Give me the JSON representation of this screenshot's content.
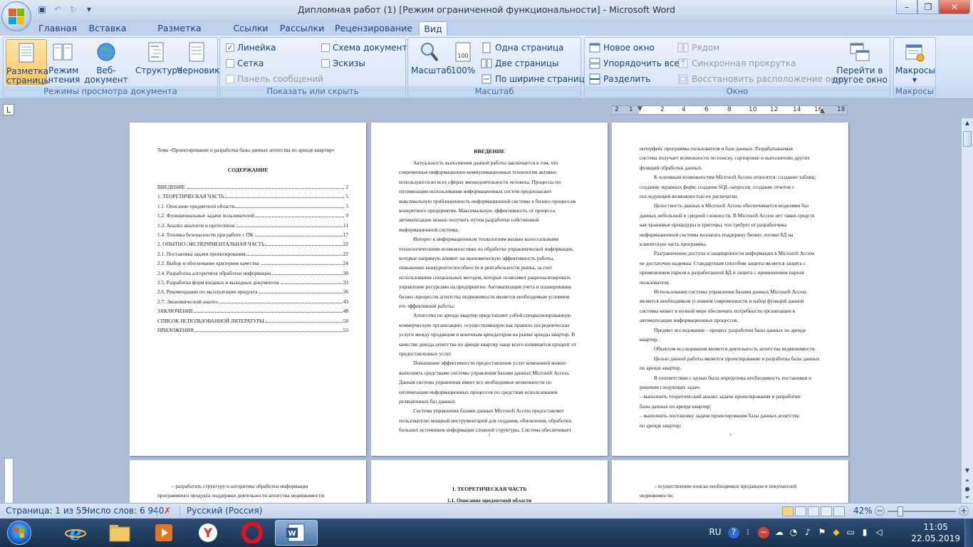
{
  "window": {
    "title": "Дипломная работ (1) [Режим ограниченной функциональности] - Microsoft Word"
  },
  "tabs": [
    {
      "label": "Главная"
    },
    {
      "label": "Вставка"
    },
    {
      "label": "Разметка страницы"
    },
    {
      "label": "Ссылки"
    },
    {
      "label": "Рассылки"
    },
    {
      "label": "Рецензирование"
    },
    {
      "label": "Вид",
      "active": true
    }
  ],
  "ribbon": {
    "doc_views": {
      "label": "Режимы просмотра документа",
      "buttons": [
        {
          "line1": "Разметка",
          "line2": "страницы",
          "selected": true
        },
        {
          "line1": "Режим",
          "line2": "чтения"
        },
        {
          "line1": "Веб-документ",
          "line2": ""
        },
        {
          "line1": "Структура",
          "line2": ""
        },
        {
          "line1": "Черновик",
          "line2": ""
        }
      ]
    },
    "show_hide": {
      "label": "Показать или скрыть",
      "ruler": {
        "label": "Линейка",
        "checked": true
      },
      "grid": {
        "label": "Сетка",
        "checked": false
      },
      "message_bar": {
        "label": "Панель сообщений",
        "checked": false
      },
      "doc_map": {
        "label": "Схема документа",
        "checked": false
      },
      "thumbnails": {
        "label": "Эскизы",
        "checked": false
      }
    },
    "zoom": {
      "label": "Масштаб",
      "zoom_btn": "Масштаб",
      "zoom100_btn": "100%",
      "one_page": "Одна страница",
      "two_pages": "Две страницы",
      "page_width": "По ширине страницы"
    },
    "window": {
      "label": "Окно",
      "new_window": "Новое окно",
      "arrange_all": "Упорядочить все",
      "split": "Разделить",
      "side_by_side": "Рядом",
      "sync_scroll": "Синхронная прокрутка",
      "reset_position": "Восстановить расположение окна",
      "switch_line1": "Перейти в",
      "switch_line2": "другое окно ▾"
    },
    "macros": {
      "label": "Макросы",
      "button": "Макросы"
    }
  },
  "ruler": {
    "corner": "L",
    "ticks": [
      "2",
      "1",
      "2",
      "4",
      "6",
      "8",
      "10",
      "12",
      "14",
      "16",
      "18"
    ]
  },
  "pages": {
    "p1": {
      "theme": "Тема «Проектирование и разработка базы данных агентства по аренде квартир»",
      "toc_title": "СОДЕРЖАНИЕ",
      "toc": [
        {
          "title": "ВВЕДЕНИЕ",
          "page": "2"
        },
        {
          "title": "1. ТЕОРЕТИЧЕСКАЯ ЧАСТЬ",
          "page": "5"
        },
        {
          "title": "1.1. Описание предметной области",
          "page": "5"
        },
        {
          "title": "1.2. Функциональные задачи пользователей",
          "page": "9"
        },
        {
          "title": "1.3. Анализ аналогов и прототипов",
          "page": "11"
        },
        {
          "title": "1.4. Техника безопасности при работе с ПК",
          "page": "17"
        },
        {
          "title": "2. ОПЫТНО-ЭКСПЕРИМЕНТАЛЬНАЯ ЧАСТЬ",
          "page": "22"
        },
        {
          "title": "2.1. Постановка задачи проектирования",
          "page": "22"
        },
        {
          "title": "2.2. Выбор и обоснование критериев качества",
          "page": "24"
        },
        {
          "title": "2.4. Разработка алгоритмов обработки информации",
          "page": "30"
        },
        {
          "title": "2.5. Разработка форм входных и выходных документов",
          "page": "33"
        },
        {
          "title": "2.6. Рекомендации по эксплуатации продукта",
          "page": "36"
        },
        {
          "title": "2.7. Экономический анализ",
          "page": "43"
        },
        {
          "title": "ЗАКЛЮЧЕНИЕ",
          "page": "48"
        },
        {
          "title": "СПИСОК ИСПОЛЬЗОВАННОЙ ЛИТЕРАТУРЫ",
          "page": "50"
        },
        {
          "title": "ПРИЛОЖЕНИЯ",
          "page": "53"
        }
      ]
    },
    "p2": {
      "heading": "ВВЕДЕНИЕ",
      "page_number": "2",
      "lines": [
        "Актуальность выполнения данной работы заключается в том, что",
        "современные информационно-коммуникационные технологии активно",
        "используются во всех сферах жизнедеятельности человека. Процессы по",
        "оптимизации использования информационных систем предполагают",
        "максимальную приближенность информационной системы к бизнес-процессам",
        "конкретного предприятия. Максимальную эффективность от процесса",
        "автоматизации можно получить путем разработки собственной",
        "информационной системы.",
        "Интерес к информационным технологиям вызван колоссальными",
        "технологическими возможностями по обработке управленческой информации,",
        "которые напрямую влияют на экономическую эффективность работы,",
        "повышение конкурентоспособности и рентабельности рынка, за счет",
        "использования специальных методов, которые позволяют рационализировать",
        "управление ресурсами на предприятии. Автоматизация учета и планирования",
        "бизнес-процессов агентства недвижимости является необходимым условием",
        "его эффективной работы.",
        "Агентство по аренде квартир представляет собой специализированную",
        "коммерческую организацию, осуществляющую как правило посреднические",
        "услуги между продавцом и конечным арендатором на рынке аренды квартир. В",
        "качестве дохода агентства по аренде квартир чаще всего понимается процент от",
        "предоставленных услуг.",
        "Повышение эффективности предоставления услуг компанией можно",
        "выполнить средствами системы управления базами данных Microsoft Access.",
        "Данная система управления имеет все необходимые возможности по",
        "оптимизации информационных процессов по средствам использования",
        "реляционных баз данных.",
        "Система управления базами данных Microsoft Access предоставляет",
        "пользователю мощный инструментарий для создания, обновления, обработки",
        "больших источников информации сложной структуры. Система обеспечивает"
      ]
    },
    "p3": {
      "page_number": "3",
      "lines": [
        "интерфейс программы пользователя и базе данных. Разрабатываемая",
        "система получает возможности по поиску, сортировке и выполнению других",
        "функций обработки данных.",
        "К основным возможностям Microsoft Access относятся: создание таблиц;",
        "создание экранных форм; создание SQL-запросов; создание отчетов с",
        "последующей возможностью их распечатки.",
        "Целостность данных в Microsoft Access обеспечивается моделями баз",
        "данных небольшой и средней сложности. В Microsoft Access нет таких средств",
        "как хранимые процедуры и триггеры, что требует от разработчика",
        "информационной системы возлагать поддержку бизнес логики БД на",
        "клиентскую часть программы.",
        "Разграничение доступа и защищенности информации в Microsoft Access",
        "не достаточно надежна. Стандартным способом защиты является защита с",
        "применением пароля к разработанной БД и защита с применением пароля",
        "пользователя.",
        "Использование системы управления базами данных Microsoft Access",
        "является необходимым условием современности и набор функций данной",
        "системы может в полной мере обеспечить потребности организации в",
        "автоматизации информационных процессов.",
        "Предмет исследования – процесс разработки базы данных по аренде",
        "квартир.",
        "Объектом исследования является деятельность агентства недвижимости.",
        "Целью данной работы является проектирование и разработка базы данных",
        "по аренде квартир.",
        "В соответствии с целью была определена необходимость постановки и",
        "решения следующих задач:",
        "– выполнить теоретический анализ задачи проектирования и разработки",
        "базы данных по аренде квартир;",
        "– выполнить постановку задачи проектирования базы данных агентства",
        "по аренде квартир;"
      ]
    },
    "p4": {
      "lines": [
        "– разработать структуру и алгоритмы обработки информации",
        "программного продукта поддержки деятельности агентства недвижимости;"
      ]
    },
    "p5": {
      "heading": "1. ТЕОРЕТИЧЕСКАЯ ЧАСТЬ",
      "subheading": "1.1. Описание предметной области"
    },
    "p6": {
      "lines": [
        "– осуществление поиска необходимых продавцов и покупателей",
        "недвижимости;"
      ]
    }
  },
  "statusbar": {
    "page": "Страница: 1 из 55",
    "words": "Число слов: 6 940",
    "language": "Русский (Россия)",
    "zoom": "42%"
  },
  "taskbar": {
    "apps": [
      "internet-explorer",
      "file-explorer",
      "media-player",
      "yandex-browser",
      "opera",
      "word"
    ],
    "lang": "RU",
    "time": "11:05",
    "date": "22.05.2019"
  }
}
